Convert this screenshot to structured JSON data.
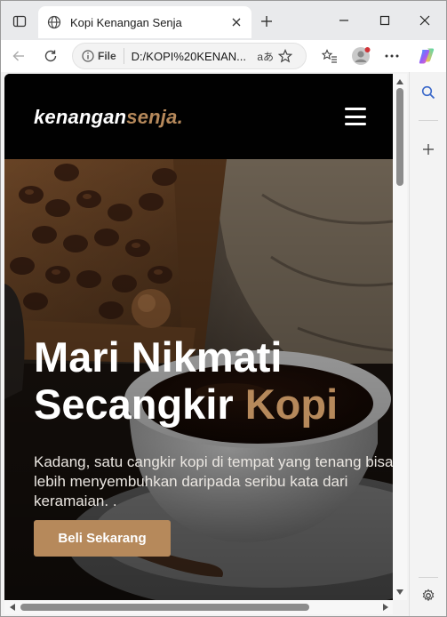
{
  "browser": {
    "tab": {
      "title": "Kopi Kenangan Senja",
      "favicon": "globe-icon"
    },
    "address": {
      "site_info_label": "File",
      "url": "D:/KOPI%20KENAN..."
    },
    "colors": {
      "tabstrip": "#e9eaec",
      "toolbar": "#ffffff",
      "sidebar": "#f3f3f3"
    }
  },
  "site": {
    "logo": {
      "main": "kenangan",
      "accent": "senja",
      "dot": "."
    },
    "hero": {
      "title_line1": "Mari Nikmati",
      "title_line2_main": "Secangkir ",
      "title_line2_accent": "Kopi",
      "text": "Kadang, satu cangkir kopi di tempat yang tenang bisa lebih menyembuhkan daripada seribu kata dari keramaian. .",
      "cta_label": "Beli Sekarang"
    },
    "colors": {
      "accent": "#b6895b",
      "nav": "#010101"
    }
  }
}
